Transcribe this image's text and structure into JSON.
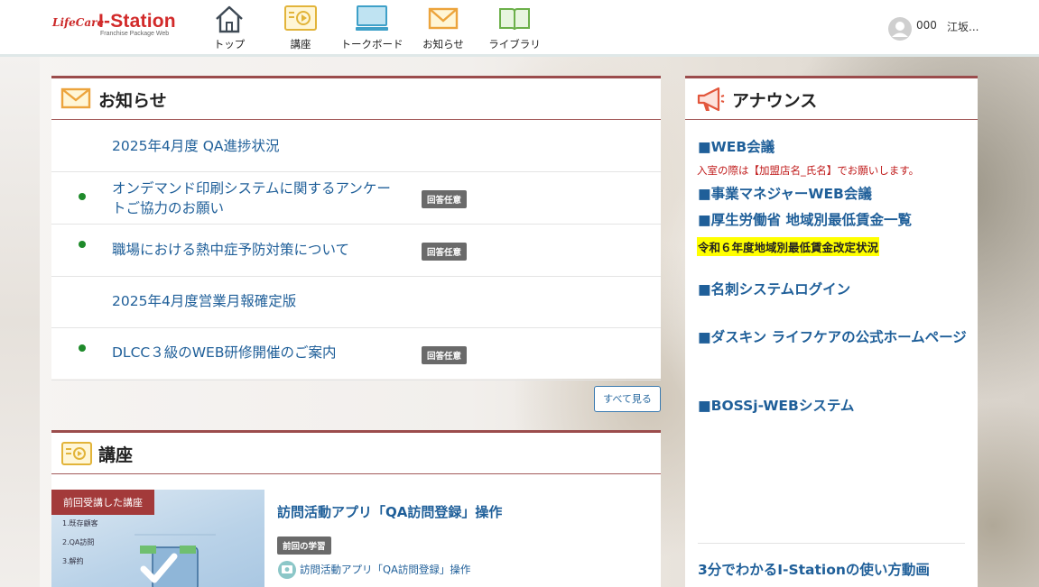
{
  "header": {
    "logo": {
      "brand_script": "LifeCare",
      "brand_main": "I-Station",
      "brand_sub": "Franchise Package Web"
    },
    "nav": [
      {
        "label": "トップ",
        "icon": "home-icon"
      },
      {
        "label": "講座",
        "icon": "video-lesson-icon"
      },
      {
        "label": "トークボード",
        "icon": "monitor-icon"
      },
      {
        "label": "お知らせ",
        "icon": "mail-icon"
      },
      {
        "label": "ライブラリ",
        "icon": "book-icon"
      }
    ],
    "user": {
      "id": "000",
      "name": "江坂..."
    }
  },
  "notice": {
    "title": "お知らせ",
    "items": [
      {
        "text": "2025年4月度 QA進捗状況",
        "badge": "",
        "dot": false
      },
      {
        "text": "オンデマンド印刷システムに関するアンケートご協力のお願い",
        "badge": "回答任意",
        "dot": true
      },
      {
        "text": "職場における熱中症予防対策について",
        "badge": "回答任意",
        "dot": true
      },
      {
        "text": "2025年4月度営業月報確定版",
        "badge": "",
        "dot": false
      },
      {
        "text": "DLCC３級のWEB研修開催のご案内",
        "badge": "回答任意",
        "dot": true
      }
    ],
    "see_all": "すべて見る"
  },
  "course": {
    "title": "講座",
    "card": {
      "tag": "前回受講した講座",
      "thumb_lines": [
        "1.既存顧客",
        "2.QA訪問",
        "3.解約"
      ],
      "title": "訪問活動アプリ「QA訪問登録」操作",
      "badge": "前回の学習",
      "sub": "訪問活動アプリ「QA訪問登録」操作"
    }
  },
  "announce": {
    "title": "アナウンス",
    "links": [
      "■WEB会議",
      "■事業マネジャーWEB会議",
      "■厚生労働省 地域別最低賃金一覧",
      "■名刺システムログイン",
      "■ダスキン ライフケアの公式ホームページ",
      "■BOSSj-WEBシステム"
    ],
    "note": "入室の際は【加盟店名_氏名】でお願いします。",
    "highlight": "令和６年度地域別最低賃金改定状況",
    "footer": "3分でわかるI-Stationの使い方動画"
  },
  "colors": {
    "accent_red": "#9b4c4c",
    "link_blue": "#1f5f99",
    "dot_green": "#1e8a2a",
    "badge_gray": "#6a6a6a",
    "alert_red": "#c01b1b",
    "highlight_yellow": "#ffff00"
  }
}
